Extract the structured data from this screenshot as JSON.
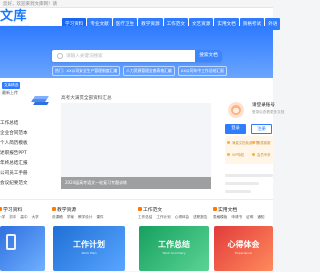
{
  "topbar": {
    "notice": "您好，欢迎来到文库网！请"
  },
  "logo": {
    "name": "文库",
    "sub": "www.wenkuwk.com"
  },
  "nav": {
    "items": [
      "学习资料",
      "专业文献",
      "医疗卫生",
      "教学资源",
      "工作范文",
      "文艺资源",
      "实用文档",
      "资格考试",
      "外语"
    ]
  },
  "search": {
    "placeholder": "请输入关键词搜索",
    "button": "搜索文档"
  },
  "tags": [
    "热门：XX公司安全生产管理制度汇编",
    "人力资源管理全套表格汇编",
    "XX公司年中工作总结汇报"
  ],
  "left": {
    "head_tag": "文库精选",
    "head_sub": "最新上传",
    "items": [
      "工作总结",
      "企业合同范本",
      "个人简历模板",
      "述职报告PPT",
      "年终总结汇报",
      "公司员工手册",
      "会议纪要范文"
    ]
  },
  "center": {
    "img_title": "高考大满贯全部资料汇总",
    "caption": "2024届高考语文一轮复习专题训练"
  },
  "login": {
    "title": "请登录账号",
    "sub": "登录后查看更多文档",
    "login_btn": "登录",
    "reg_btn": "注册",
    "perks": [
      "海量文档免费下载",
      "专属客服",
      "VIP特权",
      "会员专享"
    ]
  },
  "categories": [
    {
      "title": "学习资料",
      "links": [
        "小学",
        "初中",
        "高中",
        "大学",
        "课件",
        "试题",
        "教案",
        "作文"
      ]
    },
    {
      "title": "教学资源",
      "links": [
        "说课稿",
        "学案",
        "教学设计",
        "课件",
        "试卷",
        "反思",
        "计划",
        "总结"
      ]
    },
    {
      "title": "工作范文",
      "links": [
        "工作总结",
        "工作计划",
        "心得体会",
        "述职报告",
        "合同",
        "方案",
        "制度",
        "范文"
      ]
    },
    {
      "title": "实用文档",
      "links": [
        "表格模板",
        "申请书",
        "证明",
        "通知",
        "条据",
        "书信",
        "致辞",
        "演讲稿"
      ]
    }
  ],
  "tiles": [
    {
      "main": "工作计划",
      "sub": "Work Plan"
    },
    {
      "main": "工作总结",
      "sub": "Work Summary"
    },
    {
      "main": "心得体会",
      "sub": "Experience"
    }
  ],
  "colors": {
    "primary": "#2f7cff",
    "accent": "#ff7a00"
  }
}
